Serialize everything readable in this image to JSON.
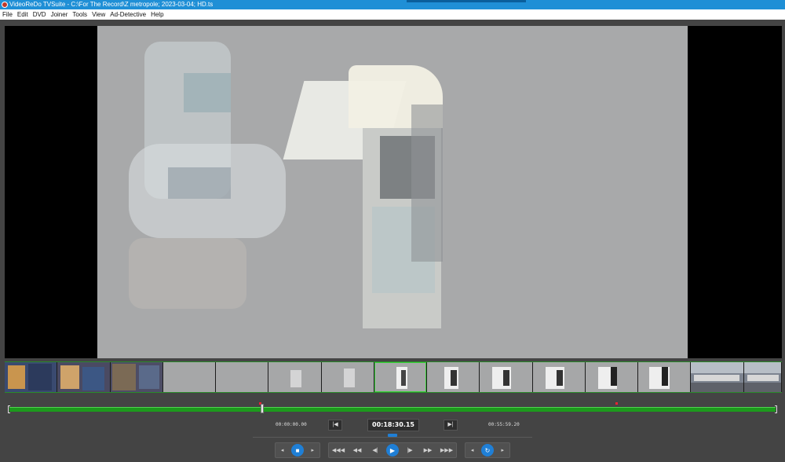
{
  "window": {
    "title": "VideoReDo TVSuite - C:\\For The Record\\Z metropole; 2023-03-04; HD.ts"
  },
  "menu": {
    "items": [
      "File",
      "Edit",
      "DVD",
      "Joiner",
      "Tools",
      "View",
      "Ad-Detective",
      "Help"
    ]
  },
  "timecodes": {
    "start": "00:00:00.00",
    "current": "00:18:30.15",
    "end": "00:55:59.20"
  },
  "timeline": {
    "position_fraction": 0.33
  },
  "icons": {
    "go_start": "skip-to-start-icon",
    "go_end": "skip-to-end-icon",
    "stop": "stop-icon",
    "play": "play-icon",
    "rewind_fast": "rewind-fast-icon",
    "rewind": "rewind-icon",
    "frame_back": "frame-back-icon",
    "frame_forward": "frame-forward-icon",
    "forward": "forward-icon",
    "forward_fast": "forward-fast-icon",
    "loop": "loop-icon"
  },
  "colors": {
    "titlebar": "#1f8fd6",
    "timeline": "#1c9a1c",
    "accent": "#1f7fd6"
  }
}
